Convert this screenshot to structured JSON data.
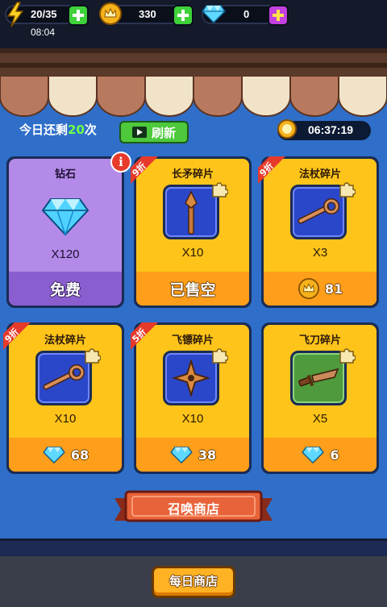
{
  "topbar": {
    "energy": "20/35",
    "gold": "330",
    "gems": "0",
    "time": "08:04"
  },
  "shop": {
    "refresh_prefix": "今日还剩",
    "refresh_count": "20",
    "refresh_suffix": "次",
    "refresh_label": "刷新",
    "timer": "06:37:19"
  },
  "cards": [
    {
      "title": "钻石",
      "qty": "X120",
      "price": "免费",
      "discount": "",
      "icon": "diamond-icon",
      "currency": ""
    },
    {
      "title": "长矛碎片",
      "qty": "X10",
      "price": "已售空",
      "discount": "9折",
      "icon": "spear-icon",
      "currency": ""
    },
    {
      "title": "法杖碎片",
      "qty": "X3",
      "price": "81",
      "discount": "9折",
      "icon": "staff-icon",
      "currency": "gold"
    },
    {
      "title": "法杖碎片",
      "qty": "X10",
      "price": "68",
      "discount": "9折",
      "icon": "staff-icon",
      "currency": "gem"
    },
    {
      "title": "飞镖碎片",
      "qty": "X10",
      "price": "38",
      "discount": "5折",
      "icon": "shuriken-icon",
      "currency": "gem"
    },
    {
      "title": "飞刀碎片",
      "qty": "X5",
      "price": "6",
      "discount": "",
      "icon": "knife-icon",
      "currency": "gem"
    }
  ],
  "summon_label": "召唤商店",
  "daily_label": "每日商店",
  "colors": {
    "background": "#2f6fc9",
    "card_yellow": "#ffc41a",
    "card_purple": "#b48ae8",
    "footer_orange": "#ff9e1a",
    "green_plus": "#3fd13a",
    "purple_plus": "#c23fe0"
  }
}
